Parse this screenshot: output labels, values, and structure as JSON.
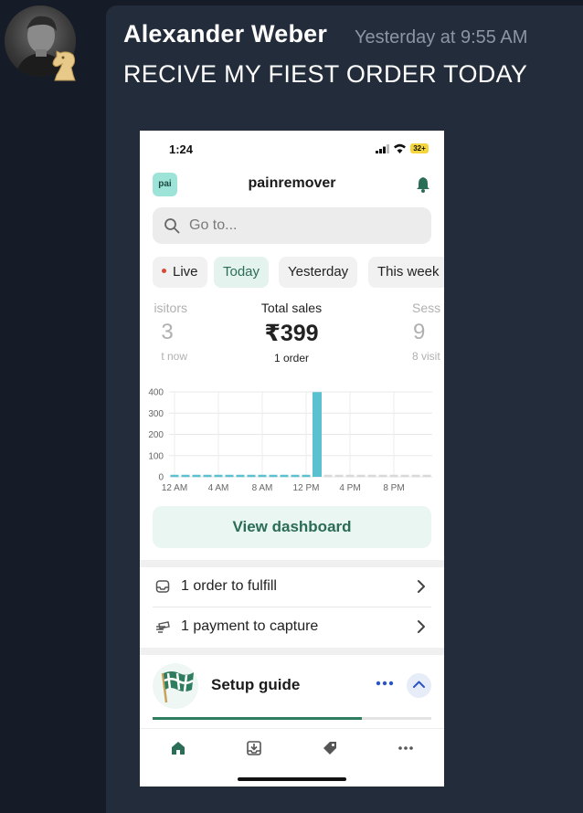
{
  "message": {
    "author": "Alexander Weber",
    "timestamp": "Yesterday at 9:55 AM",
    "text": "RECIVE MY FIEST ORDER TODAY"
  },
  "phone": {
    "status_bar": {
      "time": "1:24",
      "battery": "32+"
    },
    "header": {
      "logo_text": "pai",
      "store_name": "painremover"
    },
    "search": {
      "placeholder": "Go to..."
    },
    "filters": [
      "Live",
      "Today",
      "Yesterday",
      "This week"
    ],
    "active_filter": "Today",
    "metrics": [
      {
        "label": "isitors",
        "value": "3",
        "sub": "t now"
      },
      {
        "label": "Total sales",
        "value": "₹399",
        "sub": "1 order"
      },
      {
        "label": "Sess",
        "value": "9",
        "sub": "8 visit"
      }
    ],
    "view_dashboard_label": "View dashboard",
    "tasks": [
      {
        "label": "1 order to fulfill",
        "icon": "inbox-icon"
      },
      {
        "label": "1 payment to capture",
        "icon": "card-icon"
      }
    ],
    "setup_guide": {
      "title": "Setup guide",
      "progress": 0.75
    },
    "bottom_nav": [
      "home-icon",
      "orders-icon",
      "tag-icon",
      "more-icon"
    ],
    "colors": {
      "accent": "#2f7d5f",
      "bar": "#5bc0cf"
    }
  },
  "chart_data": {
    "type": "bar",
    "x": [
      0,
      1,
      2,
      3,
      4,
      5,
      6,
      7,
      8,
      9,
      10,
      11,
      12,
      13,
      14,
      15,
      16,
      17,
      18,
      19,
      20,
      21,
      22,
      23
    ],
    "x_tick_labels": [
      "12 AM",
      "4 AM",
      "8 AM",
      "12 PM",
      "4 PM",
      "8 PM"
    ],
    "x_ticks": [
      0,
      4,
      8,
      12,
      16,
      20
    ],
    "values": [
      0,
      0,
      0,
      0,
      0,
      0,
      0,
      0,
      0,
      0,
      0,
      0,
      0,
      399,
      0,
      0,
      0,
      0,
      0,
      0,
      0,
      0,
      0,
      0
    ],
    "ylim": [
      0,
      400
    ],
    "y_ticks": [
      0,
      100,
      200,
      300,
      400
    ],
    "grid": true
  }
}
